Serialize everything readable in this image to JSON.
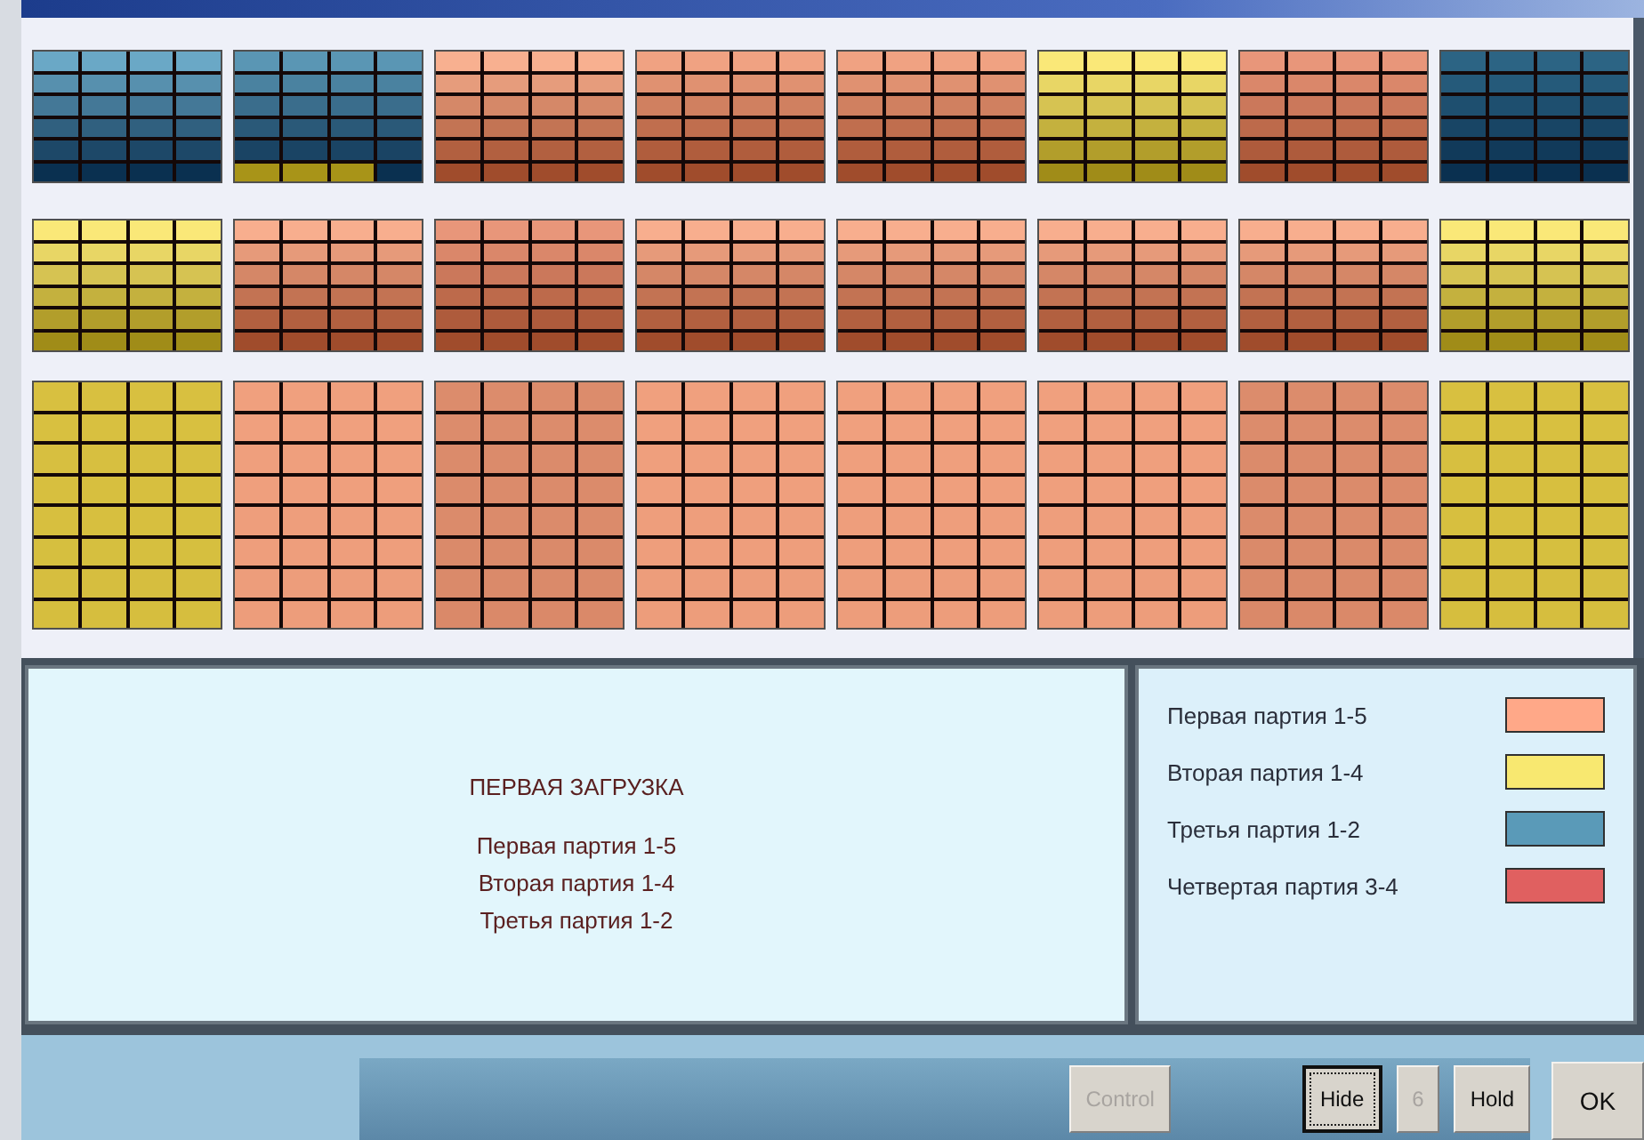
{
  "racks": [
    {
      "kind": "short",
      "blocks": [
        {
          "kind": "blue",
          "color": "#6aa8c6"
        },
        {
          "kind": "mixed",
          "color": "#5a96b4"
        },
        {
          "kind": "pink",
          "color": "#f8b090"
        },
        {
          "kind": "pink",
          "color": "#f0a282"
        },
        {
          "kind": "pink",
          "color": "#f0a282"
        },
        {
          "kind": "yellow",
          "color": "#fae878"
        },
        {
          "kind": "pink",
          "color": "#e8967a"
        },
        {
          "kind": "blue",
          "color": "#2c6484"
        }
      ]
    },
    {
      "kind": "short",
      "blocks": [
        {
          "kind": "yellow",
          "color": "#fae878"
        },
        {
          "kind": "pink",
          "color": "#f8ae8e"
        },
        {
          "kind": "pink",
          "color": "#e8967a"
        },
        {
          "kind": "pink",
          "color": "#f8ae8e"
        },
        {
          "kind": "pink",
          "color": "#f8ae8e"
        },
        {
          "kind": "pink",
          "color": "#f8ae8e"
        },
        {
          "kind": "pink",
          "color": "#f8ae8e"
        },
        {
          "kind": "yellow",
          "color": "#fae878"
        }
      ]
    },
    {
      "kind": "tall",
      "blocks": [
        {
          "kind": "yellow",
          "color": "#d8c040"
        },
        {
          "kind": "pink",
          "color": "#f0a07e"
        },
        {
          "kind": "pink",
          "color": "#dc8c6c"
        },
        {
          "kind": "pink",
          "color": "#f0a07e"
        },
        {
          "kind": "pink",
          "color": "#f0a07e"
        },
        {
          "kind": "pink",
          "color": "#f0a07e"
        },
        {
          "kind": "pink",
          "color": "#dc8c6c"
        },
        {
          "kind": "yellow",
          "color": "#d8c040"
        }
      ]
    }
  ],
  "info": {
    "title": "ПЕРВАЯ ЗАГРУЗКА",
    "lines": [
      "Первая партия 1-5",
      "Вторая партия 1-4",
      "Третья партия 1-2"
    ]
  },
  "legend": [
    {
      "label": "Первая партия 1-5",
      "color": "#ffa888"
    },
    {
      "label": "Вторая партия 1-4",
      "color": "#f8e870"
    },
    {
      "label": "Третья партия 1-2",
      "color": "#5a9ab8"
    },
    {
      "label": "Четвертая партия 3-4",
      "color": "#e06060"
    }
  ],
  "buttons": [
    {
      "label": "Control",
      "disabled": true,
      "focused": false
    },
    {
      "label": "Hide",
      "disabled": false,
      "focused": true
    },
    {
      "label": "6",
      "disabled": true,
      "focused": false
    },
    {
      "label": "Hold",
      "disabled": false,
      "focused": false
    },
    {
      "label": "OK",
      "disabled": false,
      "focused": false
    }
  ]
}
